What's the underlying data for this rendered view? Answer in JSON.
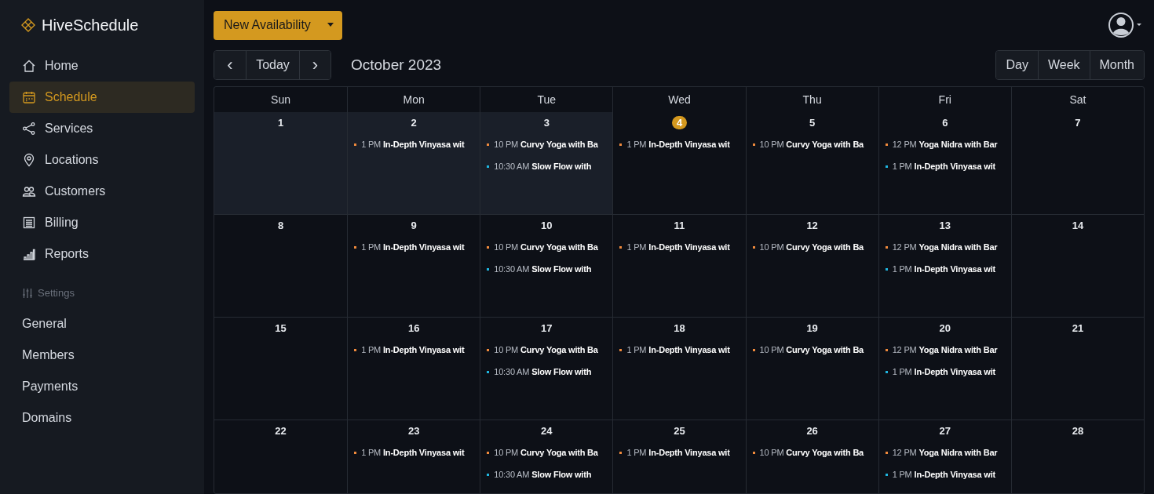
{
  "brand": "HiveSchedule",
  "nav": [
    {
      "label": "Home",
      "selected": false
    },
    {
      "label": "Schedule",
      "selected": true
    },
    {
      "label": "Services",
      "selected": false
    },
    {
      "label": "Locations",
      "selected": false
    },
    {
      "label": "Customers",
      "selected": false
    },
    {
      "label": "Billing",
      "selected": false
    },
    {
      "label": "Reports",
      "selected": false
    }
  ],
  "settings": {
    "heading": "Settings",
    "items": [
      {
        "label": "General",
        "selected": false
      },
      {
        "label": "Members",
        "selected": false
      },
      {
        "label": "Payments",
        "selected": false
      },
      {
        "label": "Domains",
        "selected": false
      }
    ]
  },
  "new_button": "New Availability",
  "nav_buttons": {
    "prev": "‹",
    "today": "Today",
    "next": "›"
  },
  "month_title": "October 2023",
  "views": [
    {
      "label": "Day",
      "selected": false
    },
    {
      "label": "Week",
      "selected": false
    },
    {
      "label": "Month",
      "selected": false
    }
  ],
  "weekdays": [
    "Sun",
    "Mon",
    "Tue",
    "Wed",
    "Thu",
    "Fri",
    "Sat"
  ],
  "weeks": [
    {
      "days": [
        {
          "date": "1",
          "shaded": true,
          "today": false
        },
        {
          "date": "2",
          "shaded": true,
          "today": false,
          "events": [
            {
              "time": "1 PM",
              "title": "In-Depth Vinyasa wit",
              "color": "#f08a3c"
            }
          ]
        },
        {
          "date": "3",
          "shaded": true,
          "today": false,
          "events": [
            {
              "time": "10 PM",
              "title": "Curvy Yoga with Ba",
              "color": "#f08a3c"
            },
            {
              "time": "10:30 AM",
              "title": "Slow Flow with",
              "color": "#1fb6e0"
            }
          ]
        },
        {
          "date": "4",
          "shaded": false,
          "today": true,
          "events": [
            {
              "time": "1 PM",
              "title": "In-Depth Vinyasa wit",
              "color": "#f08a3c"
            }
          ]
        },
        {
          "date": "5",
          "shaded": false,
          "today": false,
          "events": [
            {
              "time": "10 PM",
              "title": "Curvy Yoga with Ba",
              "color": "#f08a3c"
            }
          ]
        },
        {
          "date": "6",
          "shaded": false,
          "today": false,
          "events": [
            {
              "time": "12 PM",
              "title": "Yoga Nidra with Bar",
              "color": "#f08a3c"
            },
            {
              "time": "1 PM",
              "title": "In-Depth Vinyasa wit",
              "color": "#1fb6e0"
            }
          ]
        },
        {
          "date": "7",
          "shaded": false,
          "today": false
        }
      ]
    },
    {
      "days": [
        {
          "date": "8",
          "shaded": false,
          "today": false
        },
        {
          "date": "9",
          "shaded": false,
          "today": false,
          "events": [
            {
              "time": "1 PM",
              "title": "In-Depth Vinyasa wit",
              "color": "#f08a3c"
            }
          ]
        },
        {
          "date": "10",
          "shaded": false,
          "today": false,
          "events": [
            {
              "time": "10 PM",
              "title": "Curvy Yoga with Ba",
              "color": "#f08a3c"
            },
            {
              "time": "10:30 AM",
              "title": "Slow Flow with",
              "color": "#1fb6e0"
            }
          ]
        },
        {
          "date": "11",
          "shaded": false,
          "today": false,
          "events": [
            {
              "time": "1 PM",
              "title": "In-Depth Vinyasa wit",
              "color": "#f08a3c"
            }
          ]
        },
        {
          "date": "12",
          "shaded": false,
          "today": false,
          "events": [
            {
              "time": "10 PM",
              "title": "Curvy Yoga with Ba",
              "color": "#f08a3c"
            }
          ]
        },
        {
          "date": "13",
          "shaded": false,
          "today": false,
          "events": [
            {
              "time": "12 PM",
              "title": "Yoga Nidra with Bar",
              "color": "#f08a3c"
            },
            {
              "time": "1 PM",
              "title": "In-Depth Vinyasa wit",
              "color": "#1fb6e0"
            }
          ]
        },
        {
          "date": "14",
          "shaded": false,
          "today": false
        }
      ]
    },
    {
      "days": [
        {
          "date": "15",
          "shaded": false,
          "today": false
        },
        {
          "date": "16",
          "shaded": false,
          "today": false,
          "events": [
            {
              "time": "1 PM",
              "title": "In-Depth Vinyasa wit",
              "color": "#f08a3c"
            }
          ]
        },
        {
          "date": "17",
          "shaded": false,
          "today": false,
          "events": [
            {
              "time": "10 PM",
              "title": "Curvy Yoga with Ba",
              "color": "#f08a3c"
            },
            {
              "time": "10:30 AM",
              "title": "Slow Flow with",
              "color": "#1fb6e0"
            }
          ]
        },
        {
          "date": "18",
          "shaded": false,
          "today": false,
          "events": [
            {
              "time": "1 PM",
              "title": "In-Depth Vinyasa wit",
              "color": "#f08a3c"
            }
          ]
        },
        {
          "date": "19",
          "shaded": false,
          "today": false,
          "events": [
            {
              "time": "10 PM",
              "title": "Curvy Yoga with Ba",
              "color": "#f08a3c"
            }
          ]
        },
        {
          "date": "20",
          "shaded": false,
          "today": false,
          "events": [
            {
              "time": "12 PM",
              "title": "Yoga Nidra with Bar",
              "color": "#f08a3c"
            },
            {
              "time": "1 PM",
              "title": "In-Depth Vinyasa wit",
              "color": "#1fb6e0"
            }
          ]
        },
        {
          "date": "21",
          "shaded": false,
          "today": false
        }
      ]
    },
    {
      "days": [
        {
          "date": "22",
          "shaded": false,
          "today": false
        },
        {
          "date": "23",
          "shaded": false,
          "today": false,
          "events": [
            {
              "time": "1 PM",
              "title": "In-Depth Vinyasa wit",
              "color": "#f08a3c"
            }
          ]
        },
        {
          "date": "24",
          "shaded": false,
          "today": false,
          "events": [
            {
              "time": "10 PM",
              "title": "Curvy Yoga with Ba",
              "color": "#f08a3c"
            },
            {
              "time": "10:30 AM",
              "title": "Slow Flow with",
              "color": "#1fb6e0"
            }
          ]
        },
        {
          "date": "25",
          "shaded": false,
          "today": false,
          "events": [
            {
              "time": "1 PM",
              "title": "In-Depth Vinyasa wit",
              "color": "#f08a3c"
            }
          ]
        },
        {
          "date": "26",
          "shaded": false,
          "today": false,
          "events": [
            {
              "time": "10 PM",
              "title": "Curvy Yoga with Ba",
              "color": "#f08a3c"
            }
          ]
        },
        {
          "date": "27",
          "shaded": false,
          "today": false,
          "events": [
            {
              "time": "12 PM",
              "title": "Yoga Nidra with Bar",
              "color": "#f08a3c"
            },
            {
              "time": "1 PM",
              "title": "In-Depth Vinyasa wit",
              "color": "#1fb6e0"
            }
          ]
        },
        {
          "date": "28",
          "shaded": false,
          "today": false
        }
      ]
    }
  ]
}
